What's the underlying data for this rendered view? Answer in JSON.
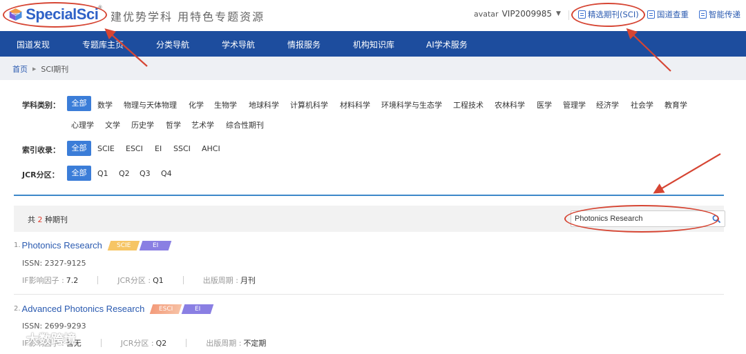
{
  "header": {
    "logo_text": "SpecialSci",
    "logo_mark": "®",
    "slogan": "建优势学科  用特色专题资源",
    "avatar_alt": "avatar",
    "user": "VIP2009985",
    "links": [
      {
        "label": "精选期刊(SCI)",
        "icon": "journal-icon"
      },
      {
        "label": "国道查重",
        "icon": "check-icon"
      },
      {
        "label": "智能传递",
        "icon": "transfer-icon"
      }
    ]
  },
  "nav": {
    "items": [
      "国道发现",
      "专题库主页",
      "分类导航",
      "学术导航",
      "情报服务",
      "机构知识库",
      "AI学术服务"
    ]
  },
  "breadcrumb": {
    "home": "首页",
    "current": "SCI期刊"
  },
  "filters": {
    "subject_label": "学科类别：",
    "subjects_row1": [
      "全部",
      "数学",
      "物理与天体物理",
      "化学",
      "生物学",
      "地球科学",
      "计算机科学",
      "材料科学",
      "环境科学与生态学",
      "工程技术",
      "农林科学",
      "医学",
      "管理学",
      "经济学",
      "社会学",
      "教育学"
    ],
    "subjects_row2": [
      "心理学",
      "文学",
      "历史学",
      "哲学",
      "艺术学",
      "综合性期刊"
    ],
    "index_label": "索引收录：",
    "indexes": [
      "全部",
      "SCIE",
      "ESCI",
      "EI",
      "SSCI",
      "AHCI"
    ],
    "jcr_label": "JCR分区：",
    "jcr": [
      "全部",
      "Q1",
      "Q2",
      "Q3",
      "Q4"
    ]
  },
  "results": {
    "count_prefix": "共",
    "count": "2",
    "count_suffix": "种期刊",
    "search_value": "Photonics Research",
    "items": [
      {
        "index": "1.",
        "name": "Photonics Research",
        "badges": [
          "SCIE",
          "EI"
        ],
        "issn": "ISSN: 2327-9125",
        "if_label": "IF影响因子 :",
        "if_value": "7.2",
        "jcr_label": "JCR分区 :",
        "jcr_value": "Q1",
        "period_label": "出版周期 :",
        "period_value": "月刊"
      },
      {
        "index": "2.",
        "name": "Advanced Photonics Research",
        "badges": [
          "ESCI",
          "EI"
        ],
        "issn": "ISSN: 2699-9293",
        "if_label": "IF影响因子 :",
        "if_value": "暂无",
        "jcr_label": "JCR分区 :",
        "jcr_value": "Q2",
        "period_label": "出版周期 :",
        "period_value": "不定期"
      }
    ]
  },
  "watermark": "大数跨境",
  "colors": {
    "primary_nav": "#1d4d9e",
    "active_chip": "#3b7dd8",
    "link": "#2a5ab0",
    "annotation": "#d64533",
    "count_highlight": "#e23b2b"
  }
}
